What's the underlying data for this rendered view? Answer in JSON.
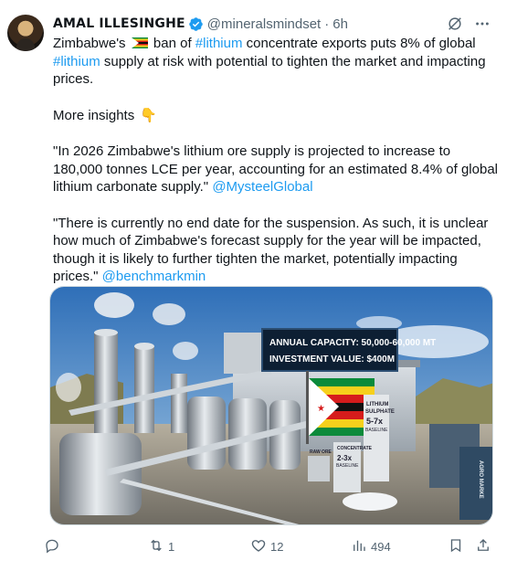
{
  "author": {
    "display_name": "AMAL ILLESINGHE",
    "handle": "@mineralsmindset",
    "separator": "·",
    "time": "6h"
  },
  "tweet": {
    "line1_a": "Zimbabwe's ",
    "line1_b": " ban of ",
    "hashtag1": "#lithium",
    "line1_c": " concentrate exports puts 8% of global",
    "hashtag2": "#lithium",
    "line2": " supply at risk with potential to tighten the market and impacting prices.",
    "para2": "More insights ",
    "para3": "\"In 2026 Zimbabwe's lithium ore supply is projected to increase to 180,000 tonnes LCE per year, accounting for an estimated 8.4% of global lithium carbonate supply.\" ",
    "mention1": "@MysteelGlobal",
    "para4": "\"There is currently no end date for the suspension. As such, it is unclear how much of Zimbabwe's forecast supply for the year will be impacted, though it is likely to further tighten the market, potentially impacting prices.\" ",
    "mention2": "@benchmarkmin"
  },
  "image": {
    "billboard_line1": "ANNUAL CAPACITY: 50,000-60,000 MT",
    "billboard_line2": "INVESTMENT VALUE: $400M",
    "label_sulphate_1": "LITHIUM",
    "label_sulphate_2": "SULPHATE",
    "label_sulphate_mult": "5-7x",
    "label_sulphate_base": "BASELINE",
    "label_concentrate": "CONCENTRATE",
    "label_conc_mult": "2-3x",
    "label_conc_base": "BASELINE",
    "label_raw": "RAW ORE",
    "label_truck": "AGRO MARKE"
  },
  "actions": {
    "replies": "",
    "retweets": "1",
    "likes": "12",
    "views": "494"
  },
  "colors": {
    "link": "#1d9bf0",
    "muted": "#536471",
    "verified": "#1d9bf0"
  },
  "icons": [
    "verified-badge-icon",
    "grok-icon",
    "more-icon",
    "reply-icon",
    "retweet-icon",
    "like-icon",
    "views-icon",
    "bookmark-icon",
    "share-icon",
    "pointing-down-emoji",
    "zimbabwe-flag-emoji"
  ]
}
